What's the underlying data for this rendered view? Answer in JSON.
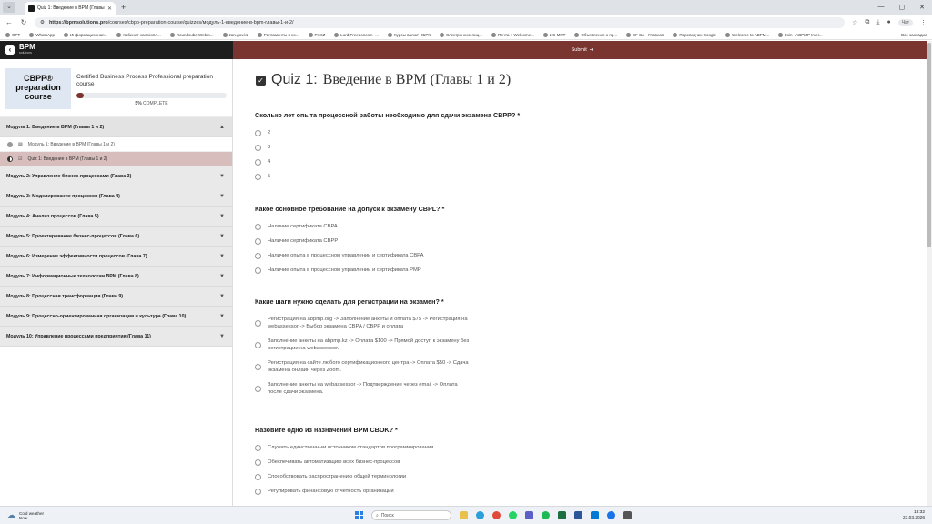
{
  "browser": {
    "tab_title": "Quiz 1: Введение в BPM (Главы 1 и 2)",
    "url_host": "https://bpmsolutions.pro",
    "url_path": "/courses/cbpp-preparation-course/quizzes/модуль-1-введение-в-bpm-главы-1-и-2/",
    "profile_label": "Чат",
    "bookmarks": [
      "GPT",
      "WhatsApp",
      "Информационная...",
      "Кабинет налогопл...",
      "Roundcube Webm...",
      "zan.gov.kz",
      "Регламенты и ко...",
      "PKKZ",
      "Lord Freeqoncoin -...",
      "Курсы валют НБРК",
      "Электронное лиц...",
      "Почта :: Welcome...",
      "ИС МПТ",
      "Объявления о пр...",
      "ЕГ-СА - Главная",
      "Переводчик Google",
      "Welcome to ABPM...",
      "Join - ABPMP Inter..."
    ],
    "all_bookmarks_label": "Все закладки"
  },
  "app": {
    "logo_title": "BPM",
    "logo_subtitle": "solutions",
    "submit_label": "Submit",
    "submit_icon": "arrow-right-icon"
  },
  "course": {
    "thumb_text": "CBPP® preparation course",
    "title": "Certified Business Process Professional preparation course",
    "progress_percent": 5,
    "progress_value": "5%",
    "progress_label": "COMPLETE"
  },
  "modules": {
    "m1": {
      "label": "Модуль 1: Введение в BPM (Главы 1 и 2)",
      "lessons": [
        {
          "label": "Модуль 1: Введение в BPM (Главы 1 и 2)"
        },
        {
          "label": "Quiz 1: Введение в BPM (Главы 1 и 2)"
        }
      ]
    },
    "m2": "Модуль 2: Управление бизнес-процессами (Глава 3)",
    "m3": "Модуль 3: Моделирование процессов (Глава 4)",
    "m4": "Модуль 4: Анализ процессов (Глава 5)",
    "m5": "Модуль 5: Проектирование бизнес-процессов (Глава 6)",
    "m6": "Модуль 6: Измерение эффективности процессов (Глава 7)",
    "m7": "Модуль 7: Информационные технологии BPM (Глава 8)",
    "m8": "Модуль 8: Процессная трансформация (Глава 9)",
    "m9": "Модуль 9: Процессно-ориентированная организация и культура (Глава 10)",
    "m10": "Модуль 10: Управление процессами предприятия (Глава 11)"
  },
  "quiz": {
    "title_prefix": "Quiz 1:",
    "title_rest": "Введение в BPM (Главы 1 и 2)",
    "questions": [
      {
        "text": "Сколько лет опыта процессной работы необходимо для сдачи экзамена CBPP? *",
        "options": [
          "2",
          "3",
          "4",
          "5"
        ]
      },
      {
        "text": "Какое основное требование на допуск к экзамену CBPL? *",
        "options": [
          "Наличие сертификата CBPA",
          "Наличие сертификата CBPP",
          "Наличие опыта в процессном управлении и сертификата CBPA",
          "Наличие опыта в процессном управлении и сертификата PMP"
        ]
      },
      {
        "text": "Какие шаги нужно сделать для регистрации на экзамен? *",
        "options": [
          "Регистрация на abpmp.org -> Заполнение анкеты и оплата $75 -> Регистрация на webassessor -> Выбор экзамена CBPA / CBPP и оплата",
          "Заполнение анкеты на abpmp.kz -> Оплата $100 -> Прямой доступ к экзамену без регистрации на webassessor.",
          "Регистрация на сайте любого сертификационного центра -> Оплата $50 -> Сдача экзамена онлайн через Zoom.",
          "Заполнение анкеты на webassessor -> Подтверждение через email -> Оплата после сдачи экзамена."
        ]
      },
      {
        "text": "Назовите одно из назначений BPM CBOK? *",
        "options": [
          "Служить единственным источником стандартов программирования",
          "Обеспечивать автоматизацию всех бизнес-процессов",
          "Способствовать распространению общей терминологии",
          "Регулировать финансовую отчетность организаций"
        ]
      }
    ]
  },
  "taskbar": {
    "weather_title": "Cold weather",
    "weather_sub": "Now",
    "search_placeholder": "Поиск",
    "time": "18:32",
    "date": "23.03.2026"
  },
  "colors": {
    "accent": "#7a3530",
    "active_lesson": "#d7bdbb"
  }
}
